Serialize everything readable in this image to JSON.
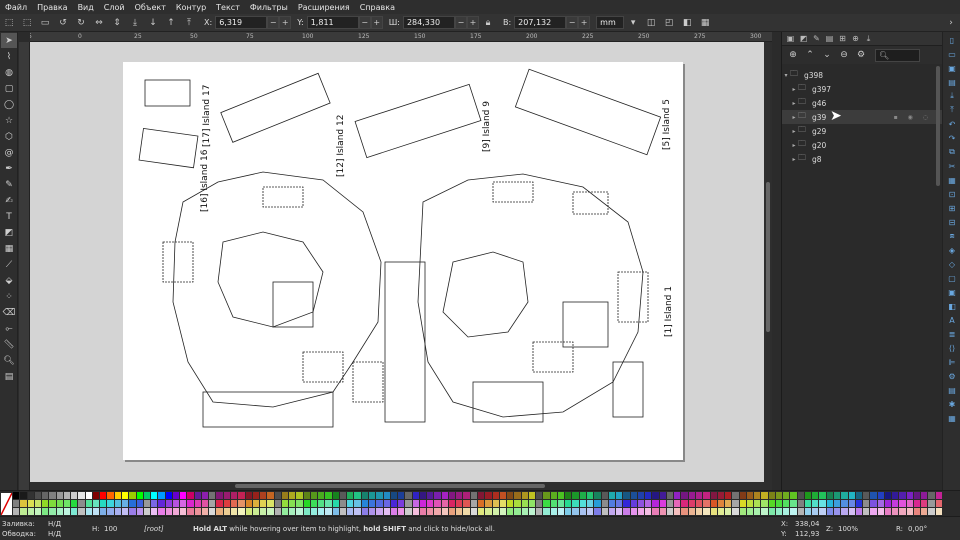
{
  "menu": [
    "Файл",
    "Правка",
    "Вид",
    "Слой",
    "Объект",
    "Контур",
    "Текст",
    "Фильтры",
    "Расширения",
    "Справка"
  ],
  "toolctl": {
    "x_label": "X:",
    "x_value": "6,319",
    "y_label": "Y:",
    "y_value": "1,811",
    "w_label": "Ш:",
    "w_value": "284,330",
    "h_label": "В:",
    "h_value": "207,132",
    "unit": "mm"
  },
  "ruler_h": [
    "-25",
    "0",
    "25",
    "50",
    "75",
    "100",
    "125",
    "150",
    "175",
    "200",
    "225",
    "250",
    "275",
    "300"
  ],
  "objects_panel": {
    "root": "g398",
    "items": [
      "g397",
      "g46",
      "g39",
      "g29",
      "g20",
      "g8"
    ]
  },
  "drawing_labels": {
    "island17": "[17] Island 17",
    "island16": "[16] Island 16",
    "island12": "[12] Island 12",
    "island9": "[9] Island 9",
    "island5": "[5] Island 5",
    "island1": "[1] Island 1"
  },
  "status": {
    "fill_label": "Заливка:",
    "fill_value": "Н/Д",
    "stroke_label": "Обводка:",
    "stroke_value": "Н/Д",
    "h_label": "Н:",
    "h_value": "100",
    "layer": "[root]",
    "hint_b1": "Hold ALT",
    "hint_t1": " while hovering over item to highlight, ",
    "hint_b2": "hold SHIFT",
    "hint_t2": " and click to hide/lock all.",
    "x_label": "X:",
    "x_value": "338,04",
    "y_label": "Y:",
    "y_value": "112,93",
    "z_label": "Z:",
    "z_value": "100%",
    "r_label": "R:",
    "r_value": "0,00°"
  },
  "colors": {
    "bg": "#2b2b2b",
    "canvas": "#d4d4d4",
    "page": "#ffffff",
    "accent": "#6aa8e0"
  }
}
